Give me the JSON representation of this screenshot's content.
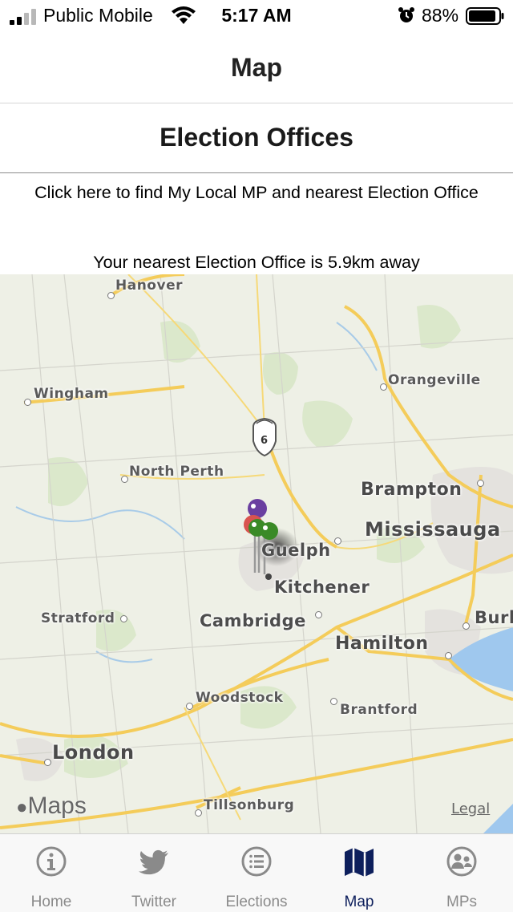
{
  "status_bar": {
    "carrier": "Public Mobile",
    "time": "5:17 AM",
    "battery": "88%",
    "icons": [
      "signal-icon",
      "wifi-icon",
      "alarm-icon",
      "battery-icon"
    ]
  },
  "nav": {
    "title": "Map"
  },
  "section": {
    "title": "Election Offices"
  },
  "info": {
    "find_link": "Click here to find My Local MP and nearest Election Office",
    "nearest": "Your nearest Election Office is 5.9km away"
  },
  "map": {
    "places": {
      "hanover": "Hanover",
      "wingham": "Wingham",
      "orangeville": "Orangeville",
      "north_perth": "North Perth",
      "brampton": "Brampton",
      "mississauga": "Mississauga",
      "guelph": "Guelph",
      "kitchener": "Kitchener",
      "stratford": "Stratford",
      "cambridge": "Cambridge",
      "hamilton": "Hamilton",
      "burl": "Burl",
      "woodstock": "Woodstock",
      "brantford": "Brantford",
      "london": "London",
      "tillsonburg": "Tillsonburg"
    },
    "highway_shield": "6",
    "logo": "Maps",
    "legal": "Legal",
    "pin_colors": [
      "#6a3fa0",
      "#d9534f",
      "#3a8a26",
      "#3a8a26"
    ]
  },
  "tabs": [
    {
      "label": "Home",
      "icon": "info-icon"
    },
    {
      "label": "Twitter",
      "icon": "twitter-icon"
    },
    {
      "label": "Elections",
      "icon": "list-icon"
    },
    {
      "label": "Map",
      "icon": "map-icon",
      "active": true
    },
    {
      "label": "MPs",
      "icon": "people-icon"
    }
  ],
  "colors": {
    "active_tab": "#0d1f5c",
    "inactive_tab": "#8a8a8a"
  }
}
